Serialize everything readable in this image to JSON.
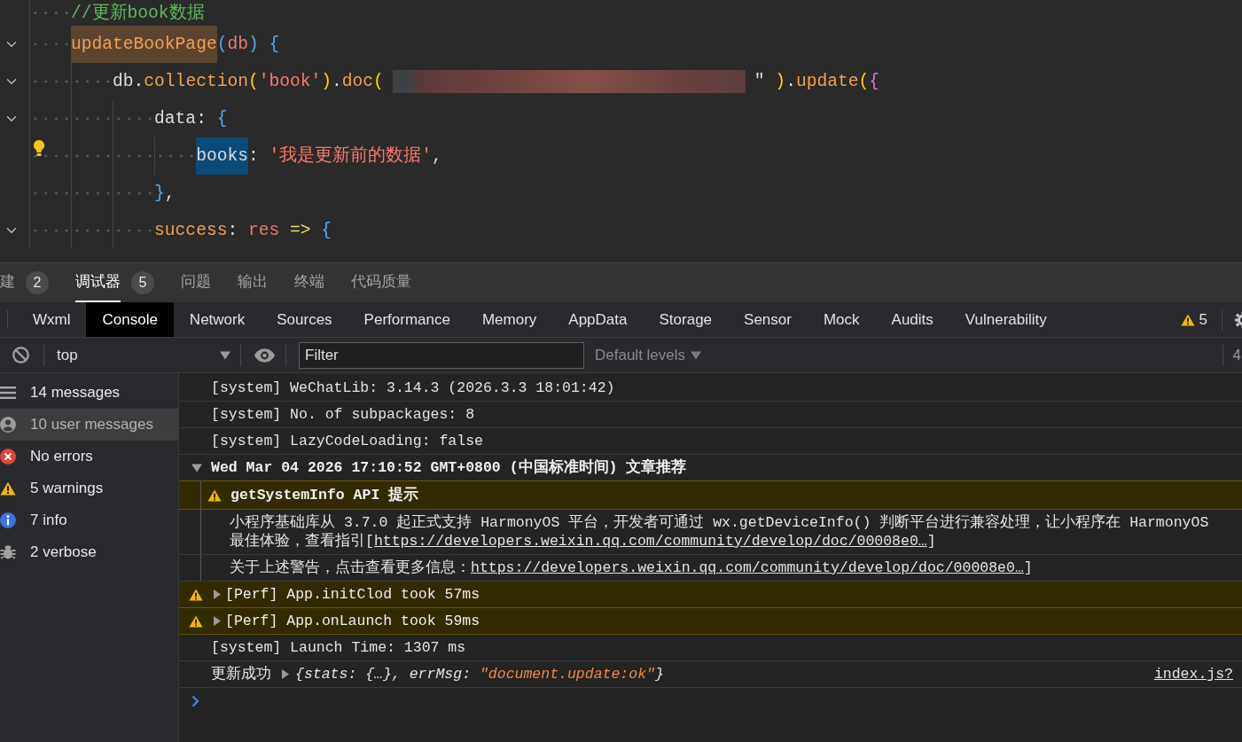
{
  "editor": {
    "lines": [
      {
        "foldable": false,
        "lightbulb": false,
        "tokens": [
          {
            "kind": "comment",
            "text": "//更新book数据"
          }
        ]
      },
      {
        "foldable": true,
        "lightbulb": false,
        "tokens": [
          {
            "kind": "function",
            "text": "updateBookPage",
            "matched": true
          },
          {
            "kind": "bracket3",
            "text": "("
          },
          {
            "kind": "param",
            "text": "db"
          },
          {
            "kind": "bracket3",
            "text": ")"
          },
          {
            "kind": "bracket3",
            "text": " {"
          }
        ],
        "children": [
          {
            "foldable": true,
            "lightbulb": false,
            "tokens": [
              {
                "kind": "text",
                "text": "db."
              },
              {
                "kind": "function",
                "text": "collection"
              },
              {
                "kind": "bracket1",
                "text": "("
              },
              {
                "kind": "string",
                "text": "'book'"
              },
              {
                "kind": "bracket1",
                "text": ")"
              },
              {
                "kind": "text",
                "text": "."
              },
              {
                "kind": "function",
                "text": "doc"
              },
              {
                "kind": "bracket1",
                "text": "("
              },
              {
                "kind": "redacted"
              },
              {
                "kind": "text",
                "text": "\""
              },
              {
                "kind": "bracket1",
                "text": " )"
              },
              {
                "kind": "text",
                "text": "."
              },
              {
                "kind": "function",
                "text": "update"
              },
              {
                "kind": "bracket1",
                "text": "("
              },
              {
                "kind": "bracket2",
                "text": "{"
              }
            ],
            "children": [
              {
                "foldable": true,
                "lightbulb": false,
                "tokens": [
                  {
                    "kind": "text",
                    "text": "data: "
                  },
                  {
                    "kind": "bracket3",
                    "text": "{"
                  }
                ],
                "children": [
                  {
                    "foldable": false,
                    "lightbulb": true,
                    "tokens": [
                      {
                        "kind": "text",
                        "text": "books",
                        "in_selection": true
                      },
                      {
                        "kind": "text",
                        "text": ": "
                      },
                      {
                        "kind": "string",
                        "text": "'我是更新前的数据'"
                      },
                      {
                        "kind": "text",
                        "text": ","
                      }
                    ]
                  }
                ]
              },
              {
                "foldable": false,
                "lightbulb": false,
                "tokens": [
                  {
                    "kind": "bracket3",
                    "text": "}"
                  },
                  {
                    "kind": "text",
                    "text": ","
                  }
                ]
              },
              {
                "foldable": true,
                "lightbulb": false,
                "tokens": [
                  {
                    "kind": "function",
                    "text": "success"
                  },
                  {
                    "kind": "text",
                    "text": ": "
                  },
                  {
                    "kind": "param",
                    "text": "res"
                  },
                  {
                    "kind": "operator",
                    "text": " =>"
                  },
                  {
                    "kind": "bracket3",
                    "text": " {"
                  }
                ]
              }
            ]
          }
        ]
      }
    ]
  },
  "panel_tabs": [
    {
      "label": "建",
      "badge": "2",
      "selected": false
    },
    {
      "label": "调试器",
      "badge": "5",
      "selected": true
    },
    {
      "label": "问题",
      "selected": false
    },
    {
      "label": "输出",
      "selected": false
    },
    {
      "label": "终端",
      "selected": false
    },
    {
      "label": "代码质量",
      "selected": false
    }
  ],
  "devtools": {
    "tabs": [
      {
        "label": "Wxml",
        "selected": false
      },
      {
        "label": "Console",
        "selected": true
      },
      {
        "label": "Network",
        "selected": false
      },
      {
        "label": "Sources",
        "selected": false
      },
      {
        "label": "Performance",
        "selected": false
      },
      {
        "label": "Memory",
        "selected": false
      },
      {
        "label": "AppData",
        "selected": false
      },
      {
        "label": "Storage",
        "selected": false
      },
      {
        "label": "Sensor",
        "selected": false
      },
      {
        "label": "Mock",
        "selected": false
      },
      {
        "label": "Audits",
        "selected": false
      },
      {
        "label": "Vulnerability",
        "selected": false
      }
    ],
    "warning_count": "5"
  },
  "toolbar": {
    "context": "top",
    "filter": {
      "placeholder": "Filter"
    },
    "levels": "Default levels",
    "hidden_count": "4"
  },
  "sidebar": {
    "items": [
      {
        "kind": "all",
        "label": "14 messages",
        "selected": false
      },
      {
        "kind": "user",
        "label": "10 user messages",
        "selected": true
      },
      {
        "kind": "error",
        "label": "No errors",
        "selected": false
      },
      {
        "kind": "warning",
        "label": "5 warnings",
        "selected": false
      },
      {
        "kind": "info",
        "label": "7 info",
        "selected": false
      },
      {
        "kind": "verbose",
        "label": "2 verbose",
        "selected": false
      }
    ]
  },
  "console": {
    "messages": [
      {
        "kind": "log",
        "text": "[system] WeChatLib: 3.14.3 (2026.3.3 18:01:42)"
      },
      {
        "kind": "log",
        "text": "[system] No. of subpackages: 8"
      },
      {
        "kind": "log",
        "text": "[system] LazyCodeLoading: false"
      },
      {
        "kind": "group",
        "expanded": true,
        "text": "Wed Mar 04 2026 17:10:52 GMT+0800 (中国标准时间) 文章推荐",
        "children": [
          {
            "kind": "heading",
            "text": "getSystemInfo API 提示"
          },
          {
            "kind": "log",
            "lines": [
              {
                "text": "小程序基础库从 3.7.0 起正式支持 HarmonyOS 平台，开发者可通过 wx.getDeviceInfo() 判断平台进行兼容处理，让小程序在 HarmonyOS"
              },
              {
                "text": "最佳体验，查看指引[",
                "link": "https://developers.weixin.qq.com/community/develop/doc/00008e0…",
                "after": "]"
              }
            ]
          },
          {
            "kind": "log",
            "lines": [
              {
                "text": "关于上述警告，点击查看更多信息：",
                "link": "https://developers.weixin.qq.com/community/develop/doc/00008e0…",
                "after": "]"
              }
            ]
          }
        ]
      },
      {
        "kind": "warning",
        "expanded": false,
        "text": "[Perf] App.initClod took 57ms"
      },
      {
        "kind": "warning",
        "expanded": false,
        "text": "[Perf] App.onLaunch took 59ms"
      },
      {
        "kind": "log",
        "text": "[system] Launch Time: 1307 ms"
      },
      {
        "kind": "result",
        "text": "更新成功",
        "object": {
          "expanded": false,
          "head": "{stats: {…}, errMsg: ",
          "value": "\"document.update:ok\"",
          "tail": "}"
        },
        "source": "index.js?"
      }
    ]
  }
}
